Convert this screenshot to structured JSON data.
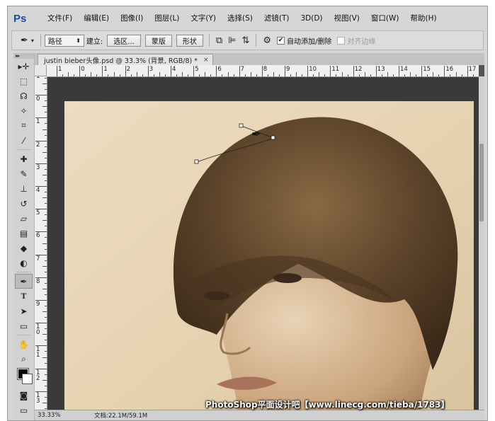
{
  "app": {
    "logo_text": "Ps",
    "brand_color": "#1b4e9e"
  },
  "menu": {
    "items": [
      "文件(F)",
      "编辑(E)",
      "图像(I)",
      "图层(L)",
      "文字(Y)",
      "选择(S)",
      "滤镜(T)",
      "3D(D)",
      "视图(V)",
      "窗口(W)",
      "帮助(H)"
    ]
  },
  "options": {
    "tool_icon": "pen-tool-icon",
    "mode_selected": "路径",
    "make_label": "建立:",
    "selection_button": "选区...",
    "mask_button": "蒙版",
    "shape_button": "形状",
    "auto_add_label": "自动添加/删除",
    "auto_add_checked": true,
    "align_edges_label": "对齐边缘",
    "align_edges_checked": false
  },
  "tools": {
    "collapse_label": "▸▸",
    "items": [
      "move-tool-icon",
      "marquee-tool-icon",
      "lasso-tool-icon",
      "quick-select-tool-icon",
      "crop-tool-icon",
      "eyedropper-tool-icon",
      "healing-brush-tool-icon",
      "brush-tool-icon",
      "clone-stamp-tool-icon",
      "history-brush-tool-icon",
      "eraser-tool-icon",
      "gradient-tool-icon",
      "blur-tool-icon",
      "dodge-tool-icon",
      "pen-tool-icon",
      "type-tool-icon",
      "path-select-tool-icon",
      "shape-tool-icon",
      "hand-tool-icon",
      "zoom-tool-icon"
    ],
    "active": "pen-tool-icon",
    "foreground_color": "#000000",
    "background_color": "#ffffff"
  },
  "document": {
    "tab_title": "justin bieber头像.psd @ 33.3% (背景, RGB/8) *",
    "tab_close": "×",
    "ruler_h_labels": [
      "1",
      "0",
      "1",
      "2",
      "3",
      "4",
      "5",
      "6",
      "7",
      "8",
      "9",
      "10",
      "11",
      "12",
      "13",
      "14",
      "15",
      "16",
      "17"
    ],
    "ruler_v_labels": [
      "1",
      "0",
      "1",
      "2",
      "3",
      "4",
      "5",
      "6",
      "7",
      "8",
      "9",
      "1\n0",
      "1\n1",
      "1\n2",
      "1\n3"
    ],
    "status_zoom": "33.33%",
    "status_doc": "文档:22.1M/59.1M"
  },
  "watermark": "PhotoShop平面设计吧【www.linecg.com/tieba/1783】"
}
